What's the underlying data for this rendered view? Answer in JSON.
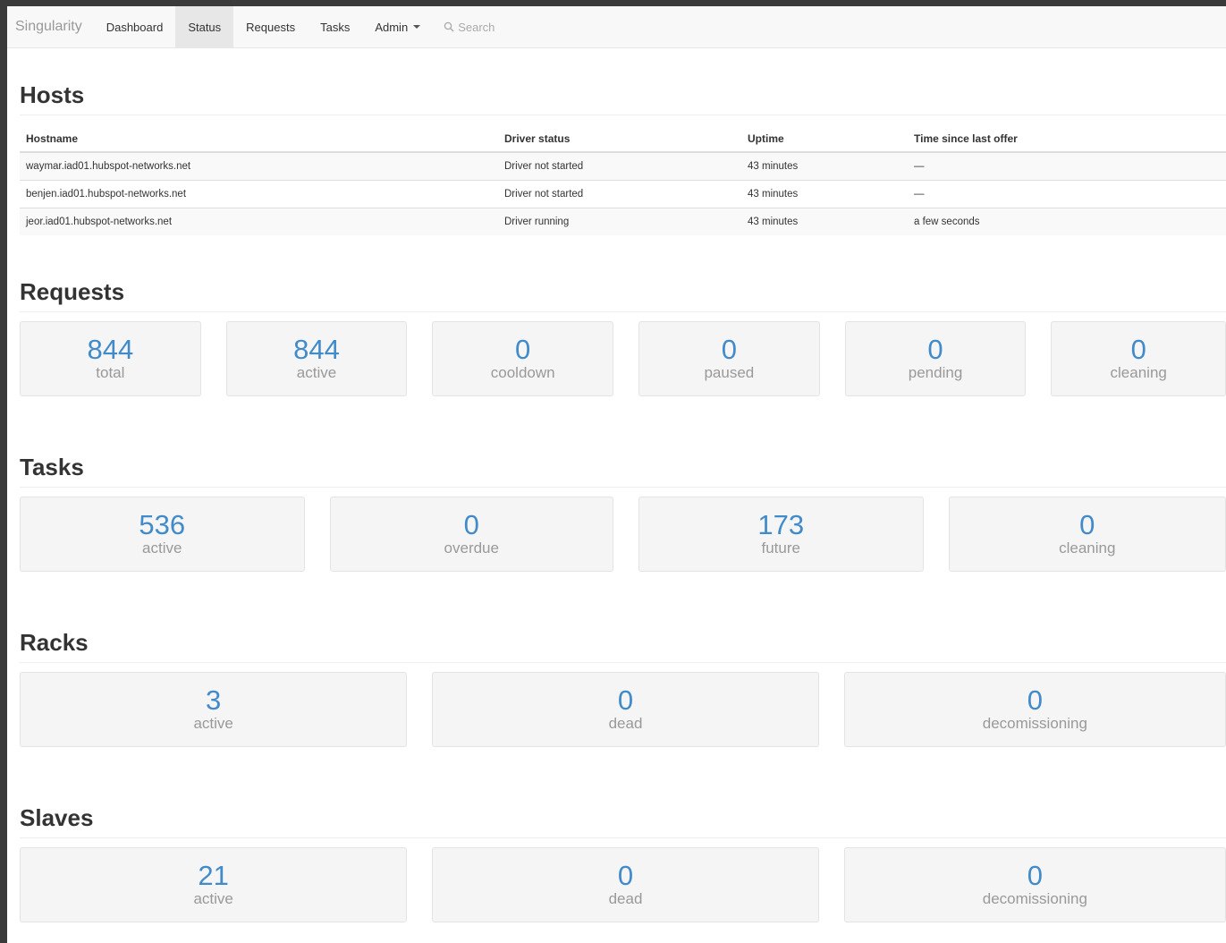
{
  "nav": {
    "brand": "Singularity",
    "items": [
      {
        "label": "Dashboard"
      },
      {
        "label": "Status"
      },
      {
        "label": "Requests"
      },
      {
        "label": "Tasks"
      },
      {
        "label": "Admin"
      }
    ],
    "active": "Status",
    "search_placeholder": "Search"
  },
  "hosts": {
    "title": "Hosts",
    "columns": [
      "Hostname",
      "Driver status",
      "Uptime",
      "Time since last offer"
    ],
    "rows": [
      [
        "waymar.iad01.hubspot-networks.net",
        "Driver not started",
        "43 minutes",
        "—"
      ],
      [
        "benjen.iad01.hubspot-networks.net",
        "Driver not started",
        "43 minutes",
        "—"
      ],
      [
        "jeor.iad01.hubspot-networks.net",
        "Driver running",
        "43 minutes",
        "a few seconds"
      ]
    ]
  },
  "requests": {
    "title": "Requests",
    "stats": [
      {
        "value": "844",
        "label": "total"
      },
      {
        "value": "844",
        "label": "active"
      },
      {
        "value": "0",
        "label": "cooldown"
      },
      {
        "value": "0",
        "label": "paused"
      },
      {
        "value": "0",
        "label": "pending"
      },
      {
        "value": "0",
        "label": "cleaning"
      }
    ]
  },
  "tasks": {
    "title": "Tasks",
    "stats": [
      {
        "value": "536",
        "label": "active"
      },
      {
        "value": "0",
        "label": "overdue"
      },
      {
        "value": "173",
        "label": "future"
      },
      {
        "value": "0",
        "label": "cleaning"
      }
    ]
  },
  "racks": {
    "title": "Racks",
    "stats": [
      {
        "value": "3",
        "label": "active"
      },
      {
        "value": "0",
        "label": "dead"
      },
      {
        "value": "0",
        "label": "decomissioning"
      }
    ]
  },
  "slaves": {
    "title": "Slaves",
    "stats": [
      {
        "value": "21",
        "label": "active"
      },
      {
        "value": "0",
        "label": "dead"
      },
      {
        "value": "0",
        "label": "decomissioning"
      }
    ]
  },
  "colors": {
    "accent": "#428bca",
    "muted": "#999999",
    "tile_bg": "#f5f5f5"
  }
}
